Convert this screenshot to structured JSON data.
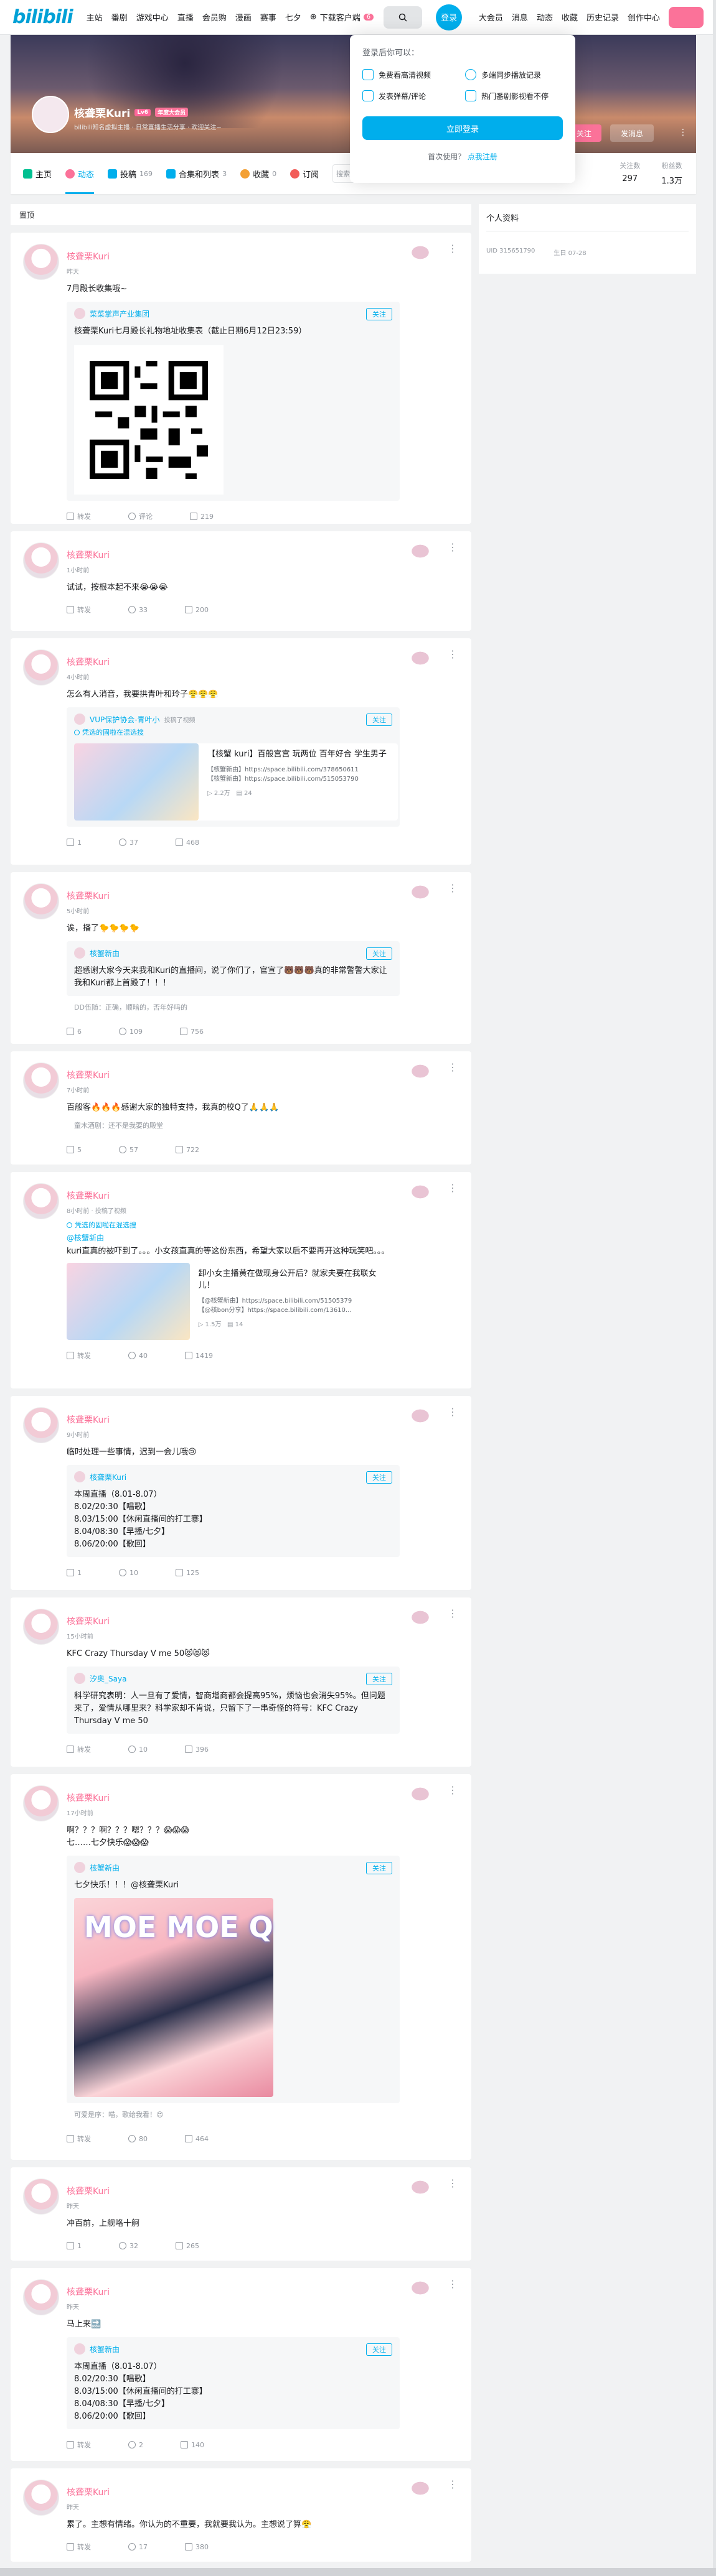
{
  "nav": {
    "logo": "bilibili",
    "items": [
      "主站",
      "番剧",
      "游戏中心",
      "直播",
      "会员购",
      "漫画",
      "赛事",
      "七夕"
    ],
    "download": "下载客户端",
    "download_badge": "6",
    "login": "登录",
    "right": [
      "大会员",
      "消息",
      "动态",
      "收藏",
      "历史记录",
      "创作中心"
    ]
  },
  "banner": {
    "username": "核聋栗Kuri",
    "level": "Lv6",
    "vip": "年度大会员",
    "sign": "bilibili知名虚拟主播 · 日常直播生活分享 · 欢迎关注~",
    "follow": "+ 关注",
    "message": "发消息"
  },
  "tabs": [
    {
      "label": "主页",
      "count": ""
    },
    {
      "label": "动态",
      "count": ""
    },
    {
      "label": "投稿",
      "count": "169"
    },
    {
      "label": "合集和列表",
      "count": "3"
    },
    {
      "label": "收藏",
      "count": "0"
    },
    {
      "label": "订阅",
      "count": ""
    }
  ],
  "space_search": "搜索视频",
  "stats": [
    {
      "label": "关注数",
      "value": "297"
    },
    {
      "label": "粉丝数",
      "value": "1.3万"
    }
  ],
  "popup": {
    "title": "登录后你可以：",
    "benefits": [
      "免费看高清视频",
      "多端同步播放记录",
      "发表弹幕/评论",
      "热门番剧影视看不停"
    ],
    "login_btn": "立即登录",
    "first": "首次使用？",
    "register": "点我注册"
  },
  "feed_header": "置顶",
  "sidebar": {
    "title": "个人资料",
    "uid": "UID  315651790",
    "birthday": "生日  07-28"
  },
  "cards": [
    {
      "name": "核聋栗Kuri",
      "time": "昨天",
      "text": "7月殿长收集哦~",
      "inner": {
        "author": "菜菜掌声产业集团",
        "follow": "关注",
        "text": "核聋栗Kuri七月殿长礼物地址收集表（截止日期6月12日23:59）"
      },
      "acts": [
        "转发",
        "评论",
        "219"
      ]
    },
    {
      "name": "核聋栗Kuri",
      "time": "1小时前",
      "text": "试试，按根本起不来😭😭😭",
      "acts": [
        "转发",
        "33",
        "200"
      ]
    },
    {
      "name": "核聋栗Kuri",
      "time": "4小时前",
      "text": "怎么有人消音，我要拱青叶和玲子😤😤😤",
      "inner": {
        "author": "VUP保护协会-青叶小",
        "meta": "投稿了视频",
        "follow": "关注",
        "topic": "凭选的固啦在混选搜",
        "video": {
          "title": "【核蟹 kuri】百般宫宫 玩两位 百年好合 学生男子",
          "desc": "【核蟹新由】https://space.bilibili.com/378650611\n【核蟹新由】https://space.bilibili.com/515053790",
          "views": "2.2万",
          "danmaku": "24"
        }
      },
      "acts": [
        "1",
        "37",
        "468"
      ]
    },
    {
      "name": "核聋栗Kuri",
      "time": "5小时前",
      "text": "诶，播了🐤🐤🐤🐤",
      "inner": {
        "author": "核蟹新由",
        "follow": "关注",
        "text": "超感谢大家今天来我和Kuri的直播间，说了你们了，官宣了🐻🐻🐻真的非常警警大家让我和Kuri都上首殿了！！！",
        "foot": "DD伍随：正确，顺暗的，否年好吗的"
      },
      "acts": [
        "6",
        "109",
        "756"
      ]
    },
    {
      "name": "核聋栗Kuri",
      "time": "7小时前",
      "text": "百般客🔥🔥🔥感谢大家的独特支持，我真的校Q了🙏🙏🙏",
      "foot": "童木酒剧：还不是我要的殿堂",
      "acts": [
        "5",
        "57",
        "722"
      ]
    },
    {
      "name": "核聋栗Kuri",
      "time": "8小时前 · 投稿了视频",
      "topic": "凭选的固啦在混选搜",
      "mention": "@核蟹新由",
      "text": "kuri直真的被吓到了。。。小女孩直真的等这份东西，希望大家以后不要再开这种玩笑吧。。。",
      "video": {
        "title": "卸小女主播黄在做现身公开后？就家夫要在我联女儿！",
        "desc": "【@核蟹新由】https://space.bilibili.com/51505379\n【@核bon分享】https://space.bilibili.com/13610...",
        "views": "1.5万",
        "danmaku": "14"
      },
      "acts": [
        "转发",
        "40",
        "1419"
      ]
    },
    {
      "name": "核聋栗Kuri",
      "time": "9小时前",
      "text": "临时处理一些事情，迟到一会儿哦😢",
      "inner": {
        "author": "核聋栗Kuri",
        "follow": "关注",
        "text": "本周直播（8.01-8.07）\n8.02/20:30【唱歌】\n8.03/15:00【休闲直播间的打工寨】\n8.04/08:30【早播/七夕】\n8.06/20:00【歌回】"
      },
      "acts": [
        "1",
        "10",
        "125"
      ]
    },
    {
      "name": "核聋栗Kuri",
      "time": "15小时前",
      "text": "KFC Crazy Thursday V me 50😻😻😻",
      "inner": {
        "author": "汐奥_Saya",
        "follow": "关注",
        "text": "科学研究表明：人一旦有了爱情，智商增商都会提高95%，烦恼也会消失95%。但问题来了，爱情从哪里来？科学家却不肯说，只留下了一串奇怪的符号：KFC Crazy Thursday V me 50"
      },
      "acts": [
        "转发",
        "10",
        "396"
      ]
    },
    {
      "name": "核聋栗Kuri",
      "time": "17小时前",
      "text": "啊？？？啊？？？嗯？？？😱😱😱\n七……七夕快乐😱😱😱",
      "inner": {
        "author": "核蟹新由",
        "follow": "关注",
        "text": "七夕快乐！！！@核聋栗Kuri",
        "moe": "MOE MOE Q",
        "foot": "可爱是序：喵，歌给我看！😍"
      },
      "acts": [
        "转发",
        "80",
        "464"
      ]
    },
    {
      "name": "核聋栗Kuri",
      "time": "昨天",
      "text": "冲百前，上舰咯十舸",
      "acts": [
        "1",
        "32",
        "265"
      ]
    },
    {
      "name": "核聋栗Kuri",
      "time": "昨天",
      "text": "马上来🔜",
      "inner": {
        "author": "核蟹新由",
        "follow": "关注",
        "text": "本周直播（8.01-8.07）\n8.02/20:30【唱歌】\n8.03/15:00【休闲直播间的打工寨】\n8.04/08:30【早播/七夕】\n8.06/20:00【歌回】"
      },
      "acts": [
        "转发",
        "2",
        "140"
      ]
    },
    {
      "name": "核聋栗Kuri",
      "time": "昨天",
      "text": "累了。主想有情绪。你认为的不重要，我就要我认为。主想说了算😤",
      "acts": [
        "转发",
        "17",
        "380"
      ]
    }
  ]
}
